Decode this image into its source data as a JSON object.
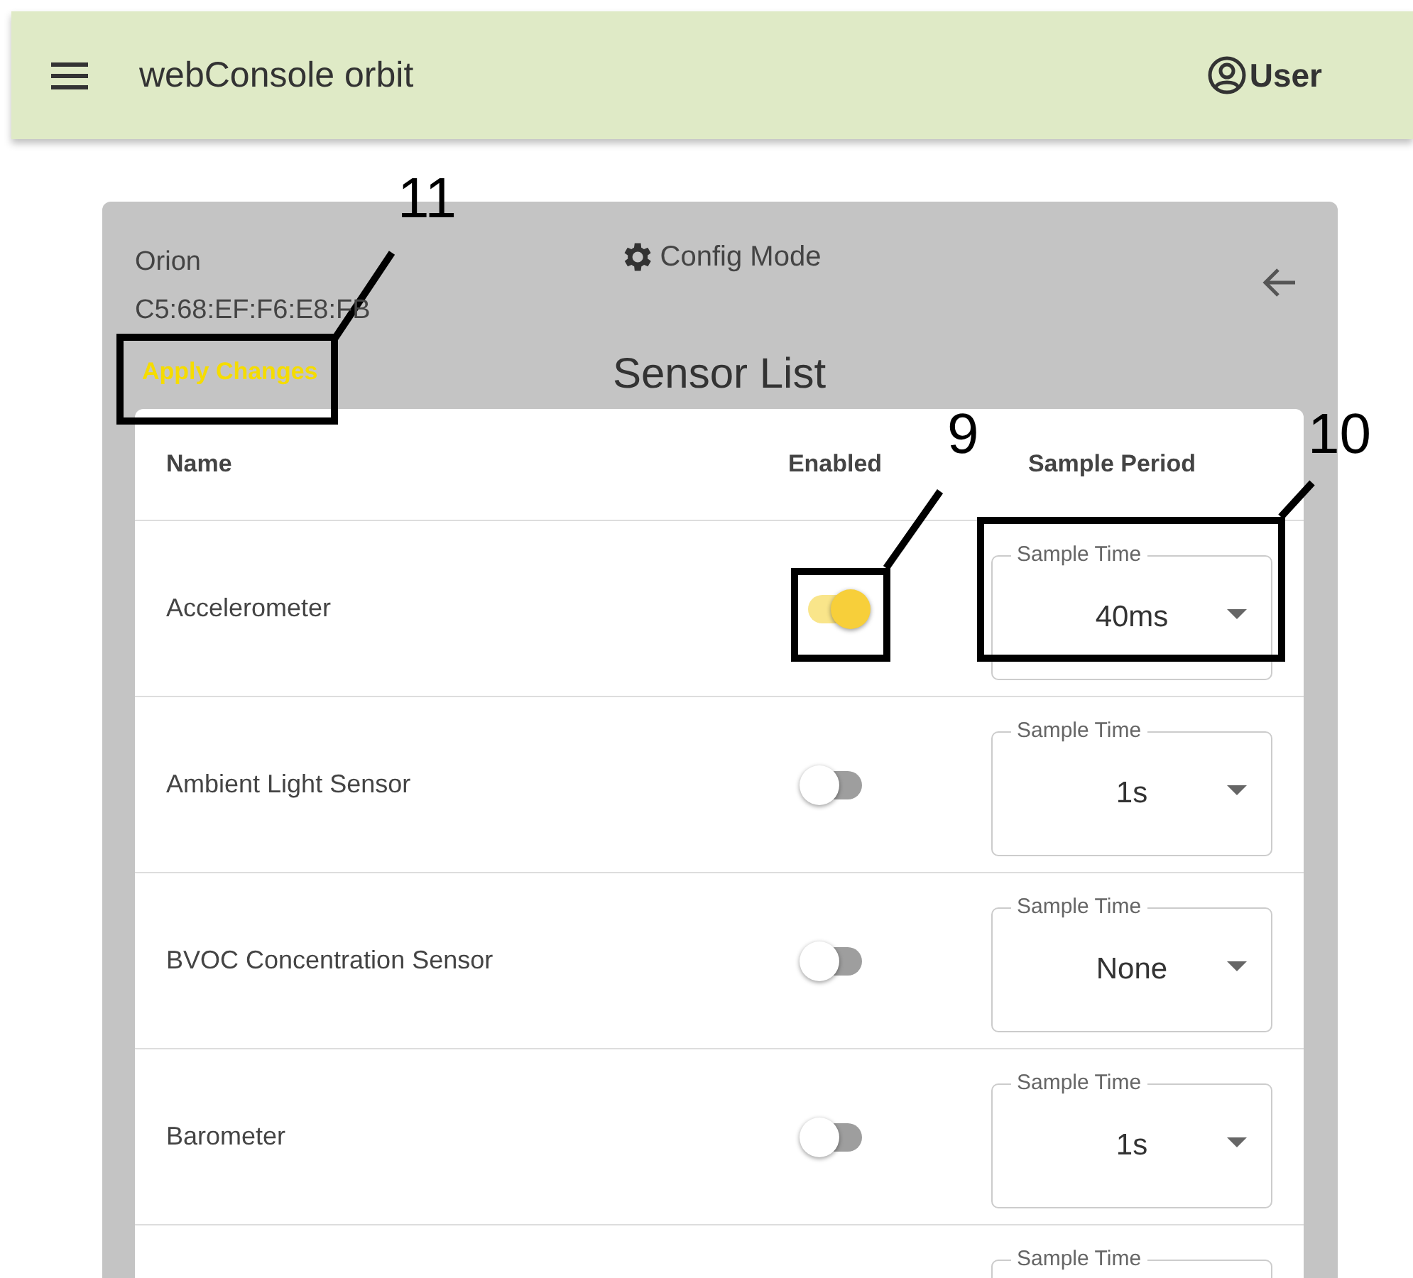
{
  "app_bar": {
    "title": "webConsole orbit",
    "user": "User"
  },
  "device": {
    "name": "Orion",
    "address": "C5:68:EF:F6:E8:FB",
    "mode": "Config Mode",
    "apply_button": "Apply Changes",
    "heading": "Sensor List"
  },
  "table": {
    "columns": [
      "Name",
      "Enabled",
      "Sample Period"
    ],
    "rows": [
      {
        "name": "Accelerometer",
        "enabled": true,
        "sample_label": "Sample Time",
        "sample_value": "40ms"
      },
      {
        "name": "Ambient Light Sensor",
        "enabled": false,
        "sample_label": "Sample Time",
        "sample_value": "1s"
      },
      {
        "name": "BVOC Concentration Sensor",
        "enabled": false,
        "sample_label": "Sample Time",
        "sample_value": "None"
      },
      {
        "name": "Barometer",
        "enabled": false,
        "sample_label": "Sample Time",
        "sample_value": "1s"
      },
      {
        "sample_label": "Sample Time"
      }
    ]
  },
  "callouts": [
    {
      "label": "11"
    },
    {
      "label": "9"
    },
    {
      "label": "10"
    }
  ]
}
